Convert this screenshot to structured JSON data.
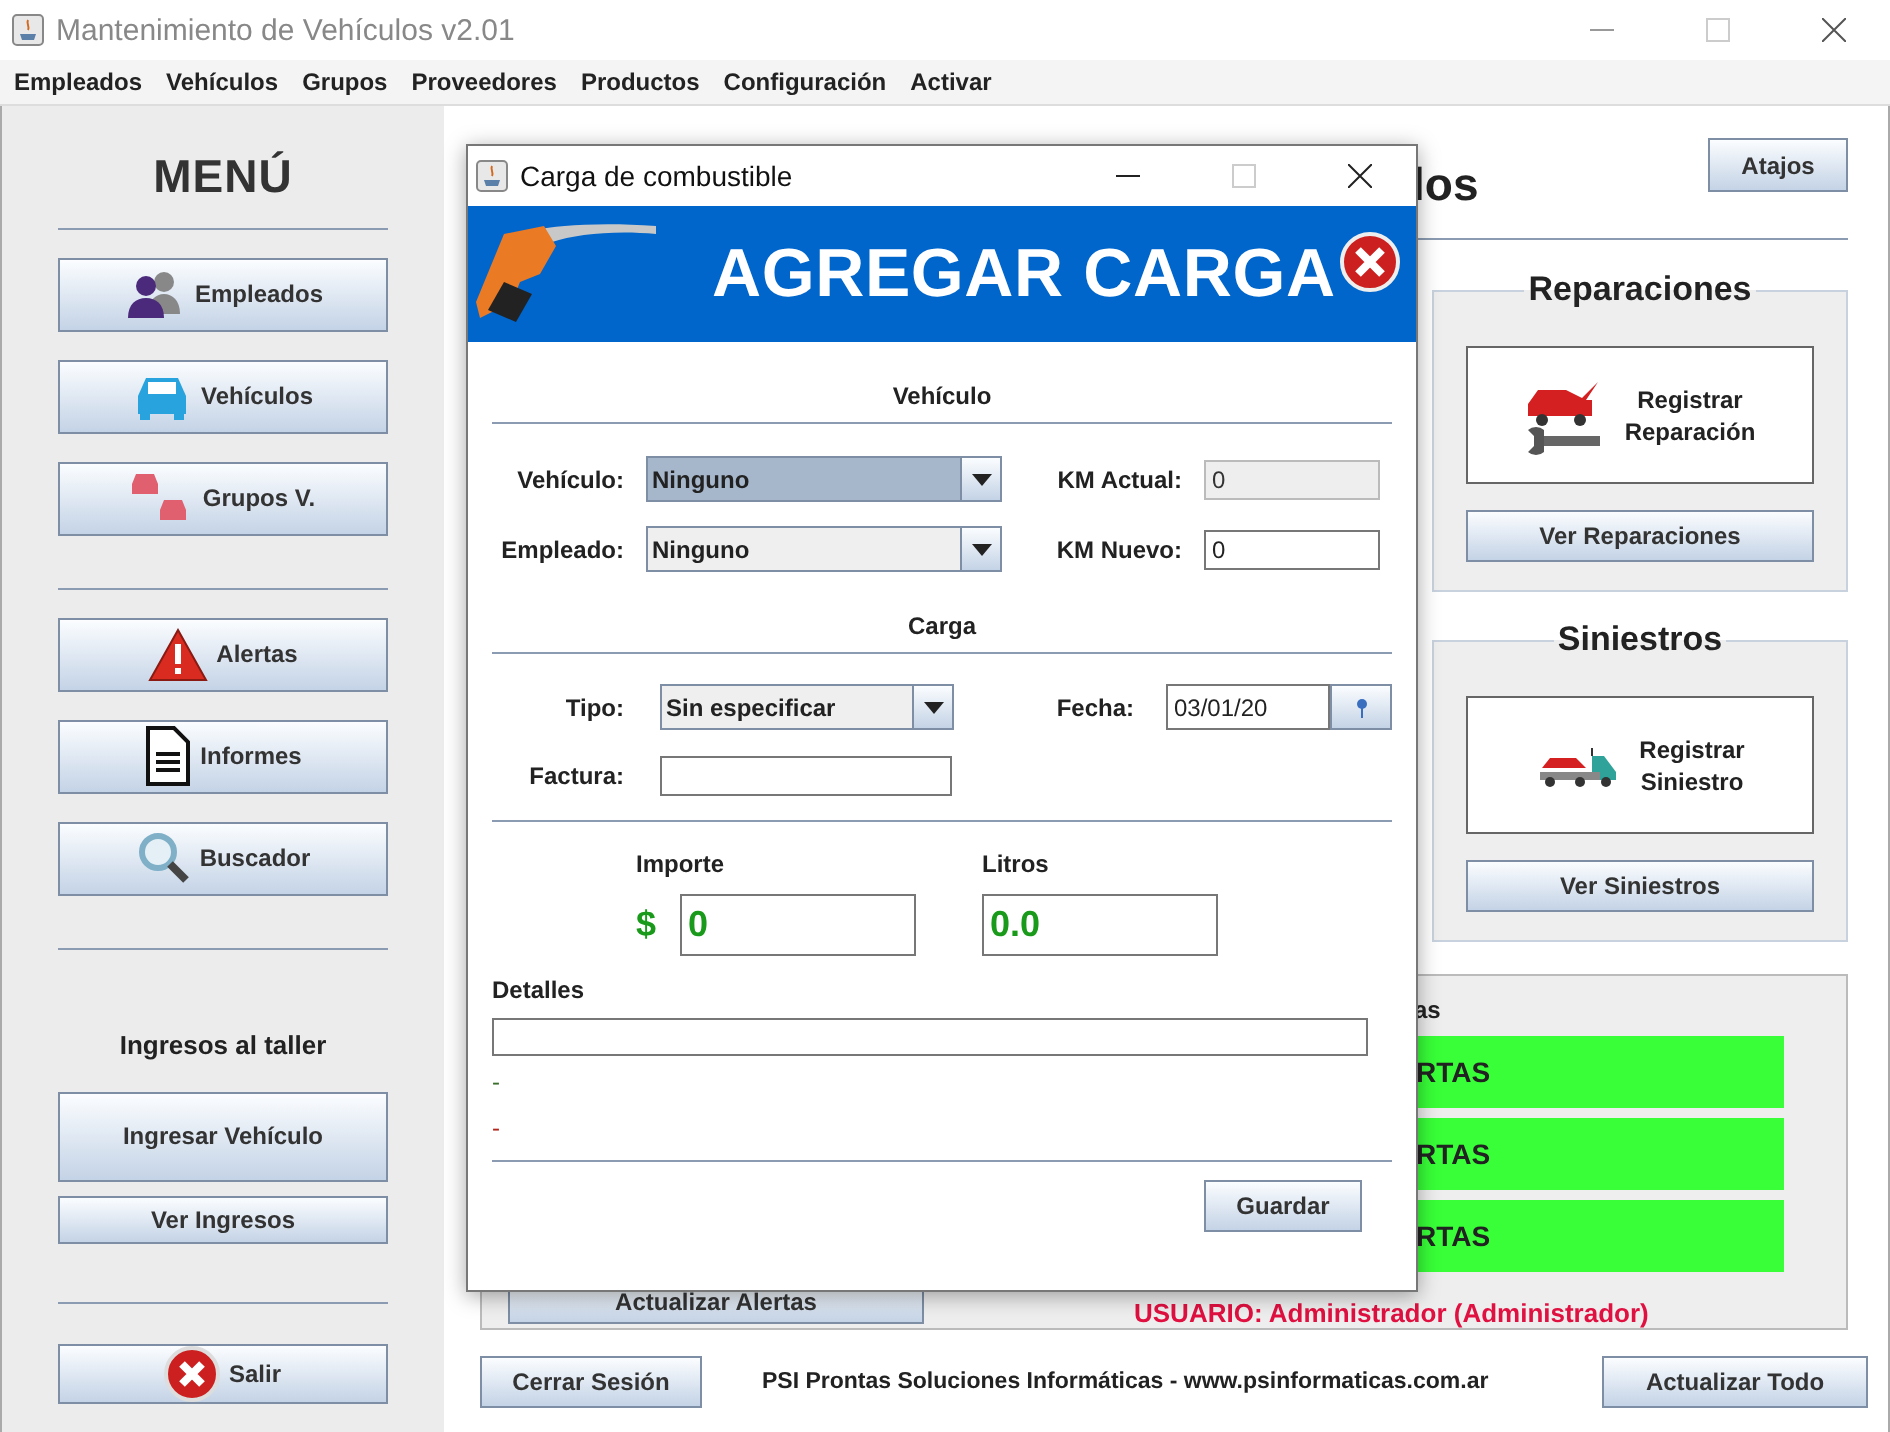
{
  "window": {
    "title": "Mantenimiento de Vehículos v2.01"
  },
  "menu": [
    "Empleados",
    "Vehículos",
    "Grupos",
    "Proveedores",
    "Productos",
    "Configuración",
    "Activar"
  ],
  "sidebar": {
    "title": "MENÚ",
    "main_buttons": [
      "Empleados",
      "Vehículos",
      "Grupos V."
    ],
    "tool_buttons": [
      "Alertas",
      "Informes",
      "Buscador"
    ],
    "workshop_heading": "Ingresos al taller",
    "workshop_buttons": [
      "Ingresar Vehículo",
      "Ver Ingresos"
    ],
    "exit_button": "Salir"
  },
  "content": {
    "title_fragment": "los",
    "shortcuts_button": "Atajos",
    "panels": [
      {
        "title": "Reparaciones",
        "action": [
          "Registrar",
          "Reparación"
        ],
        "list_button": "Ver Reparaciones"
      },
      {
        "title": "Siniestros",
        "action": [
          "Registrar",
          "Siniestro"
        ],
        "list_button": "Ver Siniestros"
      }
    ],
    "alerts": {
      "label_fragment": "as",
      "bars": [
        "RTAS",
        "RTAS",
        "RTAS"
      ],
      "refresh_button": "Actualizar Alertas",
      "user": "USUARIO: Administrador (Administrador)"
    }
  },
  "footer": {
    "logout_button": "Cerrar Sesión",
    "credits": "PSI Prontas Soluciones Informáticas - www.psinformaticas.com.ar",
    "refresh_all_button": "Actualizar Todo"
  },
  "dialog": {
    "title": "Carga de combustible",
    "banner": "AGREGAR CARGA",
    "vehicle_heading": "Vehículo",
    "vehicle": {
      "label": "Vehículo:",
      "value": "Ninguno",
      "focused": true
    },
    "employee": {
      "label": "Empleado:",
      "value": "Ninguno",
      "focused": false
    },
    "km_current": {
      "label": "KM Actual:",
      "value": "0",
      "disabled": true
    },
    "km_new": {
      "label": "KM Nuevo:",
      "value": "0",
      "disabled": false
    },
    "load_heading": "Carga",
    "type": {
      "label": "Tipo:",
      "value": "Sin especificar"
    },
    "date": {
      "label": "Fecha:",
      "value": "03/01/20"
    },
    "invoice": {
      "label": "Factura:"
    },
    "amount": {
      "label": "Importe",
      "currency": "$",
      "value": "0"
    },
    "liters": {
      "label": "Litros",
      "value": "0.0"
    },
    "details": {
      "label": "Detalles"
    },
    "status_lines": [
      {
        "text": "-",
        "color": "#3a6e2a"
      },
      {
        "text": "-",
        "color": "#b3261e"
      }
    ],
    "save_button": "Guardar"
  }
}
